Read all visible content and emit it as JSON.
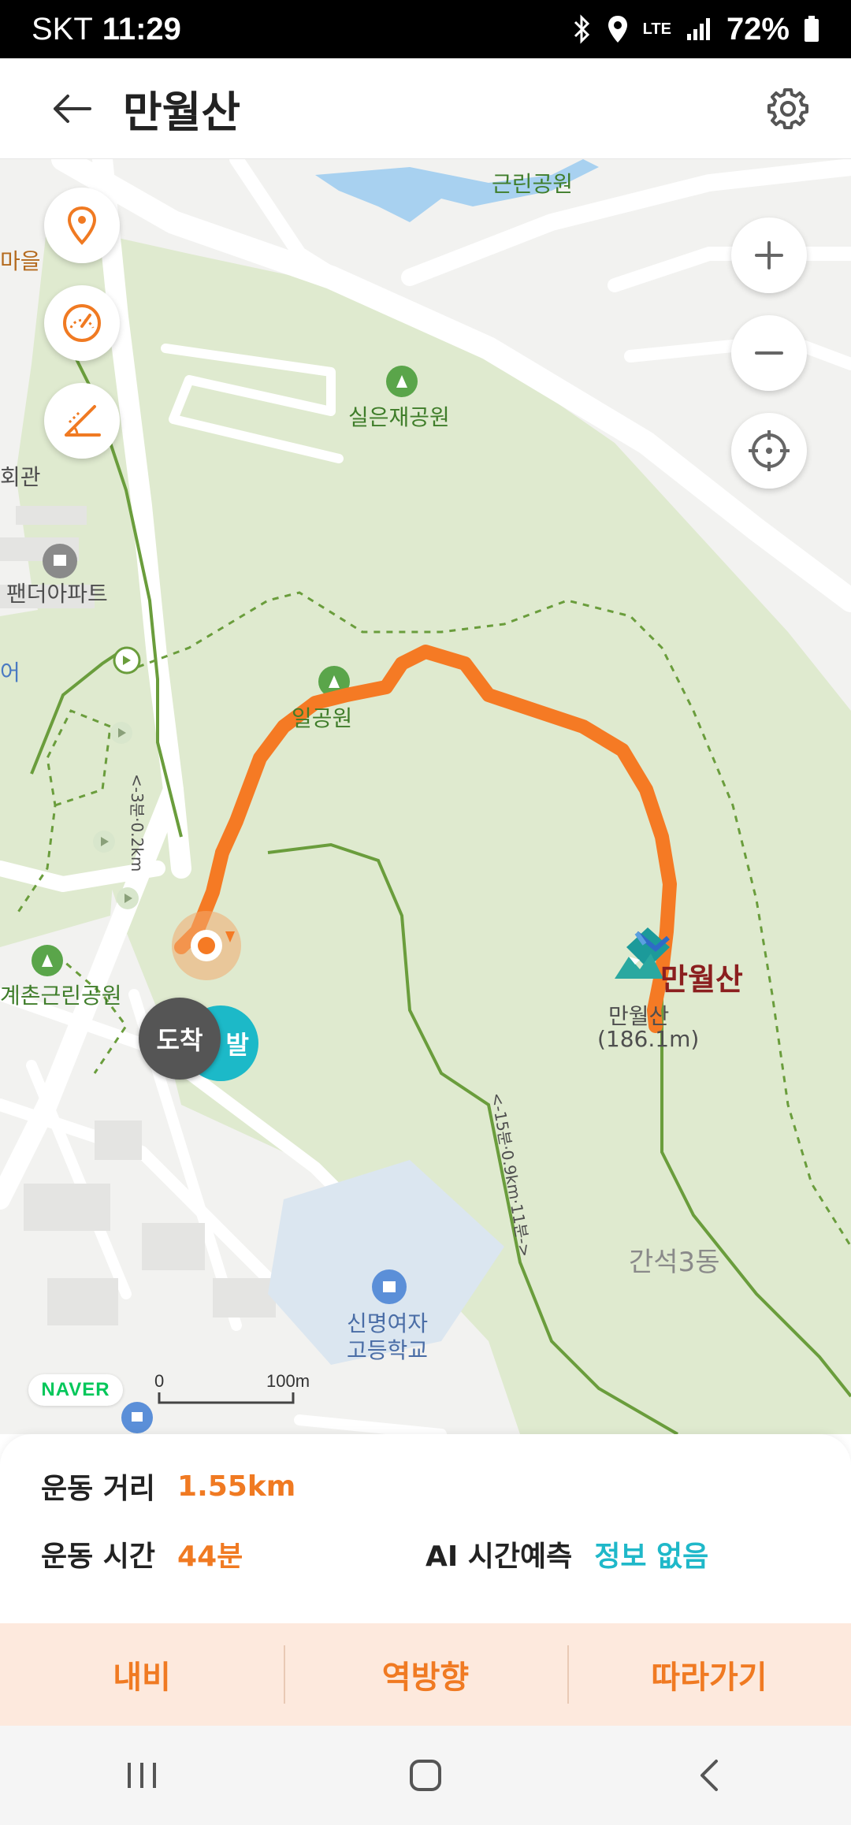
{
  "status_bar": {
    "carrier": "SKT",
    "time": "11:29",
    "network": "LTE",
    "battery": "72%"
  },
  "header": {
    "title": "만월산"
  },
  "map": {
    "labels": {
      "park1": "근린공원",
      "park2": "실은재공원",
      "village": "마을",
      "hall": "회관",
      "apt": "팬더아파트",
      "left_edge": "어",
      "park3": "일공원",
      "park4": "계촌근린공원",
      "peak_name": "만월산",
      "peak_label": "만월산",
      "peak_height": "(186.1m)",
      "district": "간석3동",
      "school_line1": "신명여자",
      "school_line2": "고등학교",
      "trail1": "<-3분·0.2km",
      "trail2": "<-15분·0.9km·11분->"
    },
    "markers": {
      "arrive": "도착",
      "start": "발"
    },
    "naver_logo": "NAVER",
    "scale": {
      "zero": "0",
      "distance": "100m"
    }
  },
  "info": {
    "distance_label": "운동 거리",
    "distance_value": "1.55km",
    "time_label": "운동 시간",
    "time_value": "44분",
    "ai_label": "AI 시간예측",
    "ai_value": "정보 없음"
  },
  "actions": {
    "navi": "내비",
    "reverse": "역방향",
    "follow": "따라가기"
  },
  "colors": {
    "accent": "#f07a22",
    "teal": "#1fb8c9",
    "route": "#f57a24",
    "park": "#dfeacf"
  }
}
